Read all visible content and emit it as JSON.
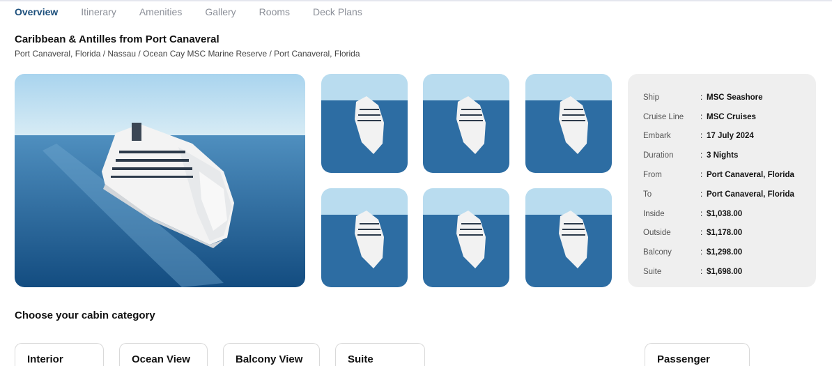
{
  "tabs": [
    "Overview",
    "Itinerary",
    "Amenities",
    "Gallery",
    "Rooms",
    "Deck Plans"
  ],
  "header": {
    "title": "Caribbean & Antilles from Port Canaveral",
    "route": "Port Canaveral, Florida / Nassau / Ocean Cay MSC Marine Reserve / Port Canaveral, Florida"
  },
  "info": [
    {
      "label": "Ship",
      "value": "MSC Seashore"
    },
    {
      "label": "Cruise Line",
      "value": "MSC Cruises"
    },
    {
      "label": "Embark",
      "value": "17 July 2024"
    },
    {
      "label": "Duration",
      "value": "3 Nights"
    },
    {
      "label": "From",
      "value": "Port Canaveral, Florida"
    },
    {
      "label": "To",
      "value": "Port Canaveral, Florida"
    },
    {
      "label": "Inside",
      "value": "$1,038.00"
    },
    {
      "label": "Outside",
      "value": "$1,178.00"
    },
    {
      "label": "Balcony",
      "value": "$1,298.00"
    },
    {
      "label": "Suite",
      "value": "$1,698.00"
    }
  ],
  "info_colon": ":",
  "cabin": {
    "heading": "Choose your cabin category",
    "categories": [
      "Interior",
      "Ocean View",
      "Balcony View",
      "Suite"
    ],
    "passenger": "Passenger"
  },
  "colors": {
    "active_tab": "#1c4f7c",
    "sea": "#1f5f93",
    "sky": "#b9dcef"
  }
}
